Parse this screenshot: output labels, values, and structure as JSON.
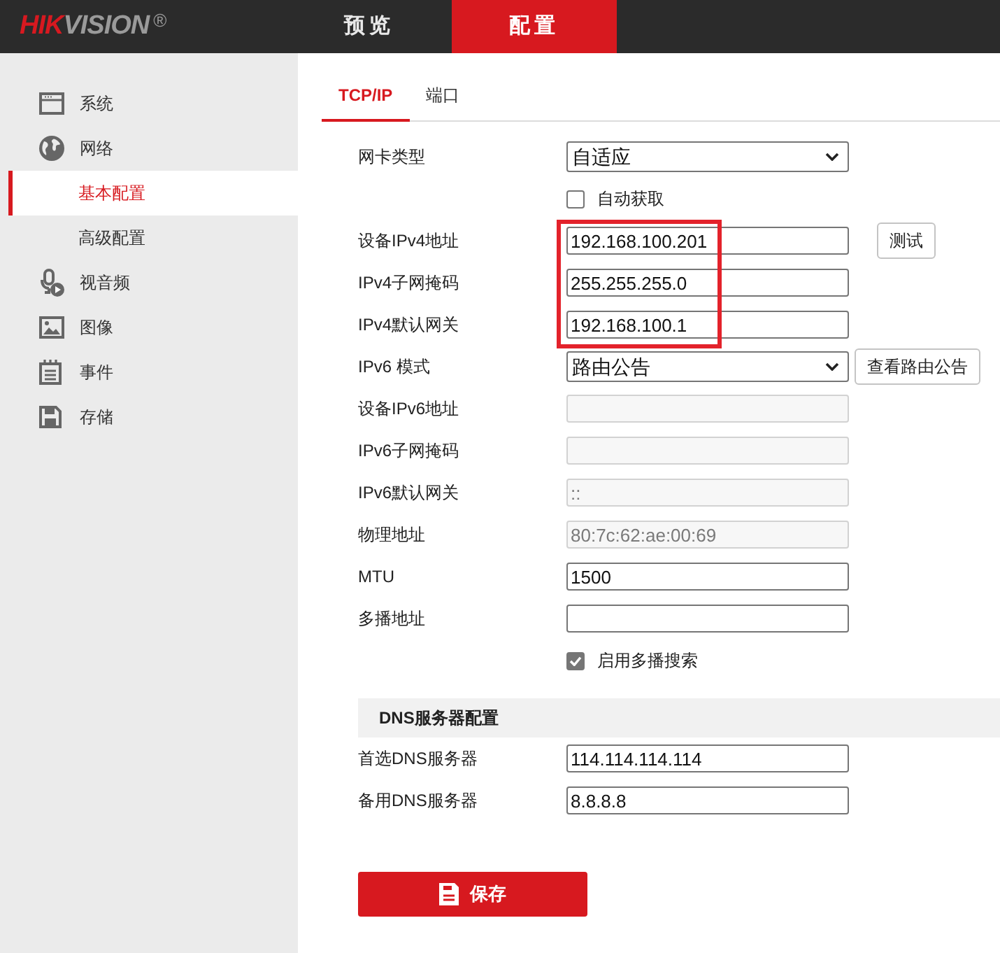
{
  "header": {
    "logo": {
      "accent": "HIK",
      "rest": "VISION",
      "mark": "®"
    },
    "nav": [
      {
        "label": "预览",
        "selected": false
      },
      {
        "label": "配置",
        "selected": true
      }
    ]
  },
  "sidebar": {
    "items": [
      {
        "label": "系统",
        "selected": false
      },
      {
        "label": "网络",
        "selected": false,
        "children": [
          {
            "label": "基本配置",
            "selected": true
          },
          {
            "label": "高级配置",
            "selected": false
          }
        ]
      },
      {
        "label": "视音频",
        "selected": false
      },
      {
        "label": "图像",
        "selected": false
      },
      {
        "label": "事件",
        "selected": false
      },
      {
        "label": "存储",
        "selected": false
      }
    ]
  },
  "tabs": [
    {
      "label": "TCP/IP",
      "selected": true
    },
    {
      "label": "端口",
      "selected": false
    }
  ],
  "form": {
    "rows": [
      {
        "kind": "select",
        "label": "网卡类型",
        "value": "自适应",
        "disabled": false,
        "highlighted": false
      },
      {
        "kind": "checkbox",
        "label": "自动获取",
        "checked": false,
        "highlighted": false
      },
      {
        "kind": "input",
        "label": "设备IPv4地址",
        "value": "192.168.100.201",
        "disabled": false,
        "highlighted": true,
        "button": "测试"
      },
      {
        "kind": "input",
        "label": "IPv4子网掩码",
        "value": "255.255.255.0",
        "disabled": false,
        "highlighted": true
      },
      {
        "kind": "input",
        "label": "IPv4默认网关",
        "value": "192.168.100.1",
        "disabled": false,
        "highlighted": true
      },
      {
        "kind": "select",
        "label": "IPv6 模式",
        "value": "路由公告",
        "disabled": false,
        "highlighted": false,
        "button": "查看路由公告"
      },
      {
        "kind": "input",
        "label": "设备IPv6地址",
        "disabled": true,
        "highlighted": false
      },
      {
        "kind": "input",
        "label": "IPv6子网掩码",
        "disabled": true,
        "highlighted": false
      },
      {
        "kind": "input",
        "label": "IPv6默认网关",
        "value": "::",
        "disabled": true,
        "highlighted": false
      },
      {
        "kind": "input",
        "label": "物理地址",
        "value": "80:7c:62:ae:00:69",
        "disabled": true,
        "highlighted": false
      },
      {
        "kind": "input",
        "label": "MTU",
        "value": "1500",
        "disabled": false,
        "highlighted": false
      },
      {
        "kind": "input",
        "label": "多播地址",
        "disabled": false,
        "highlighted": false
      },
      {
        "kind": "checkbox",
        "label": "启用多播搜索",
        "checked": true,
        "highlighted": false
      }
    ]
  },
  "dns": {
    "title": "DNS服务器配置",
    "rows": [
      {
        "kind": "input",
        "label": "首选DNS服务器",
        "value": "114.114.114.114",
        "disabled": false,
        "highlighted": false
      },
      {
        "kind": "input",
        "label": "备用DNS服务器",
        "value": "8.8.8.8",
        "disabled": false,
        "highlighted": false
      }
    ]
  },
  "save_button": {
    "label": "保存"
  }
}
